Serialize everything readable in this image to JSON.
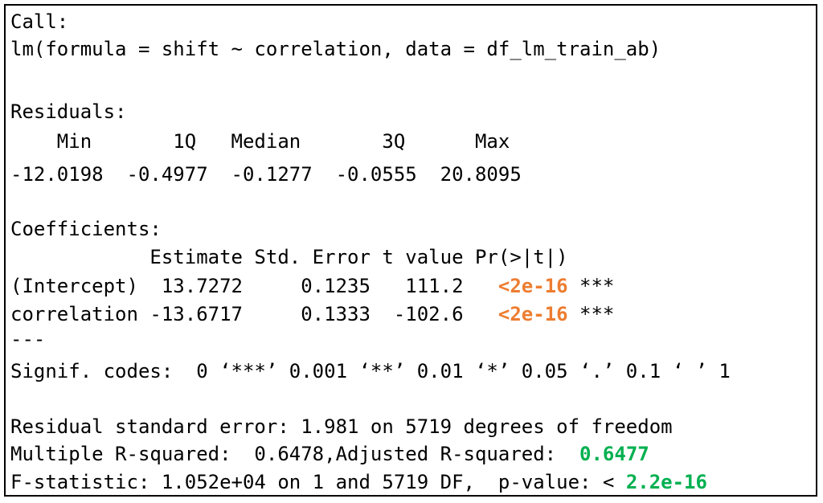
{
  "colors": {
    "p_value_highlight": "#ed7d31",
    "r_squared_highlight": "#00b050",
    "text": "#000000",
    "border": "#000000"
  },
  "call": {
    "label": "Call:",
    "formula": "lm(formula = shift ~ correlation, data = df_lm_train_ab)"
  },
  "residuals": {
    "label": "Residuals:",
    "header": "    Min       1Q   Median       3Q      Max ",
    "values": "-12.0198  -0.4977  -0.1277  -0.0555  20.8095 "
  },
  "coefficients": {
    "label": "Coefficients:",
    "header": "            Estimate Std. Error t value Pr(>|t|)    ",
    "rows": [
      {
        "prefix": "(Intercept)  13.7272     0.1235   111.2   ",
        "p_value": "<2e-16",
        "stars": " ***"
      },
      {
        "prefix": "correlation -13.6717     0.1333  -102.6   ",
        "p_value": "<2e-16",
        "stars": " ***"
      }
    ],
    "separator": "---",
    "signif_codes": "Signif. codes:  0 ‘***’ 0.001 ‘**’ 0.01 ‘*’ 0.05 ‘.’ 0.1 ‘ ’ 1"
  },
  "summary": {
    "residual_se": "Residual standard error: 1.981 on 5719 degrees of freedom",
    "r_squared_prefix": "Multiple R-squared:  0.6478,Adjusted R-squared:  ",
    "adjusted_r_squared": "0.6477",
    "f_stat_prefix": "F-statistic: 1.052e+04 on 1 and 5719 DF,  p-value: < ",
    "p_value": "2.2e-16"
  }
}
